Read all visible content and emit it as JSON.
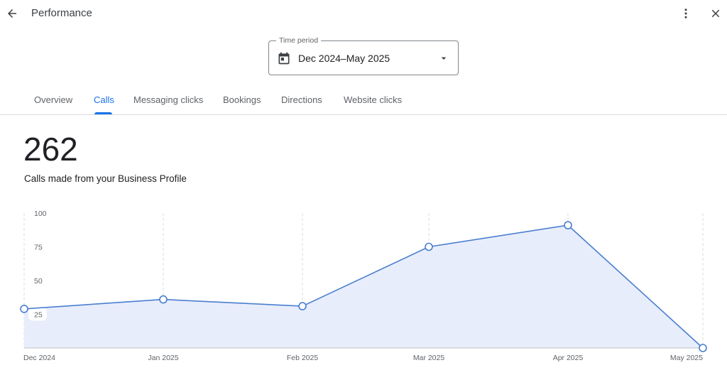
{
  "header": {
    "title": "Performance",
    "back_icon": "arrow-back-icon",
    "more_icon": "more-vert-icon",
    "close_icon": "close-icon"
  },
  "time_period": {
    "label": "Time period",
    "value": "Dec 2024–May 2025",
    "icon": "calendar-icon"
  },
  "tabs": [
    {
      "label": "Overview",
      "active": false
    },
    {
      "label": "Calls",
      "active": true
    },
    {
      "label": "Messaging clicks",
      "active": false
    },
    {
      "label": "Bookings",
      "active": false
    },
    {
      "label": "Directions",
      "active": false
    },
    {
      "label": "Website clicks",
      "active": false
    }
  ],
  "metric": {
    "value": "262",
    "description": "Calls made from your Business Profile"
  },
  "colors": {
    "accent": "#1a73e8",
    "line": "#4a7fcf",
    "area": "#e8edfc"
  },
  "chart_data": {
    "type": "area",
    "x": [
      "Dec 2024",
      "Jan 2025",
      "Feb 2025",
      "Mar 2025",
      "Apr 2025",
      "May 2025"
    ],
    "values": [
      29,
      36,
      31,
      75,
      91,
      0
    ],
    "yticks": [
      100,
      75,
      50,
      25
    ],
    "ylim": [
      0,
      100
    ],
    "grid": "vertical-dashed"
  }
}
